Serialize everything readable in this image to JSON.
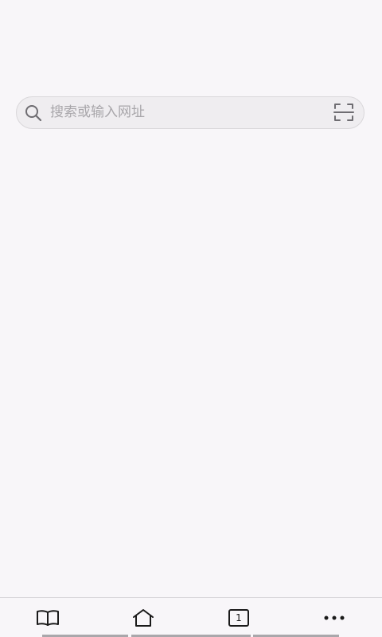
{
  "search": {
    "placeholder": "搜索或输入网址",
    "value": ""
  },
  "bottom_nav": {
    "items": [
      {
        "name": "bookmarks",
        "icon": "book-icon"
      },
      {
        "name": "home",
        "icon": "home-icon"
      },
      {
        "name": "tabs",
        "icon": "tabs-icon",
        "count": "1"
      },
      {
        "name": "menu",
        "icon": "more-icon"
      }
    ]
  },
  "colors": {
    "background": "#f8f6f9",
    "search_fill": "#efedf0",
    "placeholder": "#a8a6aa",
    "icon": "#1a1a1a"
  }
}
